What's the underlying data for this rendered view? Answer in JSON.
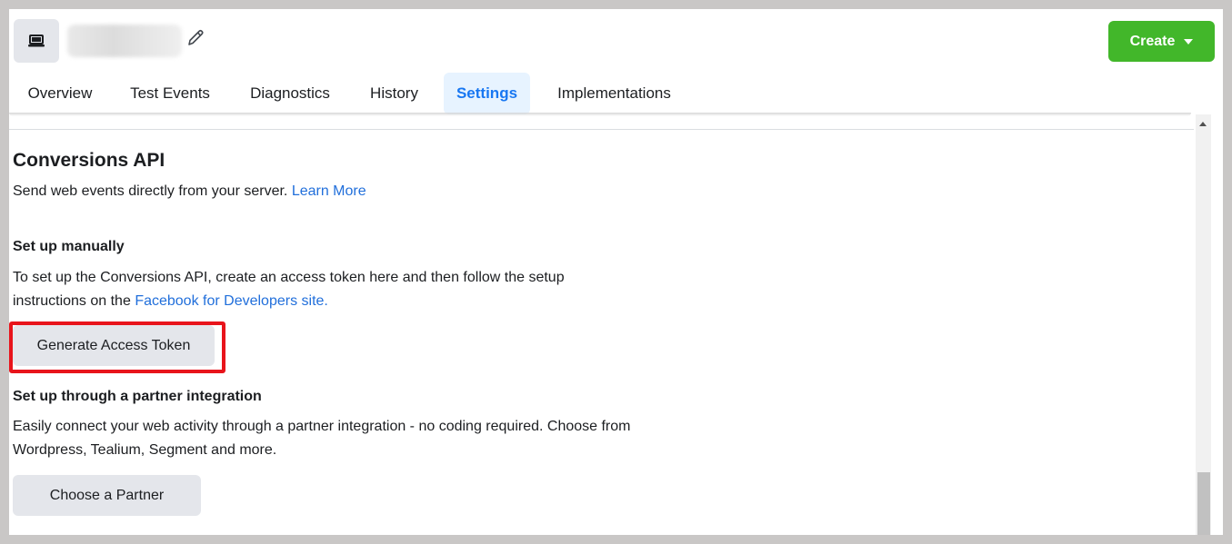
{
  "header": {
    "create_label": "Create"
  },
  "tabs": [
    {
      "label": "Overview"
    },
    {
      "label": "Test Events"
    },
    {
      "label": "Diagnostics"
    },
    {
      "label": "History"
    },
    {
      "label": "Settings",
      "active": true
    },
    {
      "label": "Implementations"
    }
  ],
  "conversions_api": {
    "title": "Conversions API",
    "description": "Send web events directly from your server.",
    "learn_more": "Learn More"
  },
  "manual_setup": {
    "heading": "Set up manually",
    "text_line1": "To set up the Conversions API, create an access token here and then follow the setup",
    "text_line2_prefix": "instructions on the",
    "link": "Facebook for Developers site.",
    "button_label": "Generate Access Token"
  },
  "partner_setup": {
    "heading": "Set up through a partner integration",
    "text_line1": "Easily connect your web activity through a partner integration - no coding required. Choose from",
    "text_line2": "Wordpress, Tealium, Segment and more.",
    "button_label": "Choose a Partner"
  },
  "colors": {
    "create_green": "#42b72a",
    "link_blue": "#216fdb",
    "active_tab_blue": "#1877f2",
    "highlight_red": "#e8141b"
  }
}
